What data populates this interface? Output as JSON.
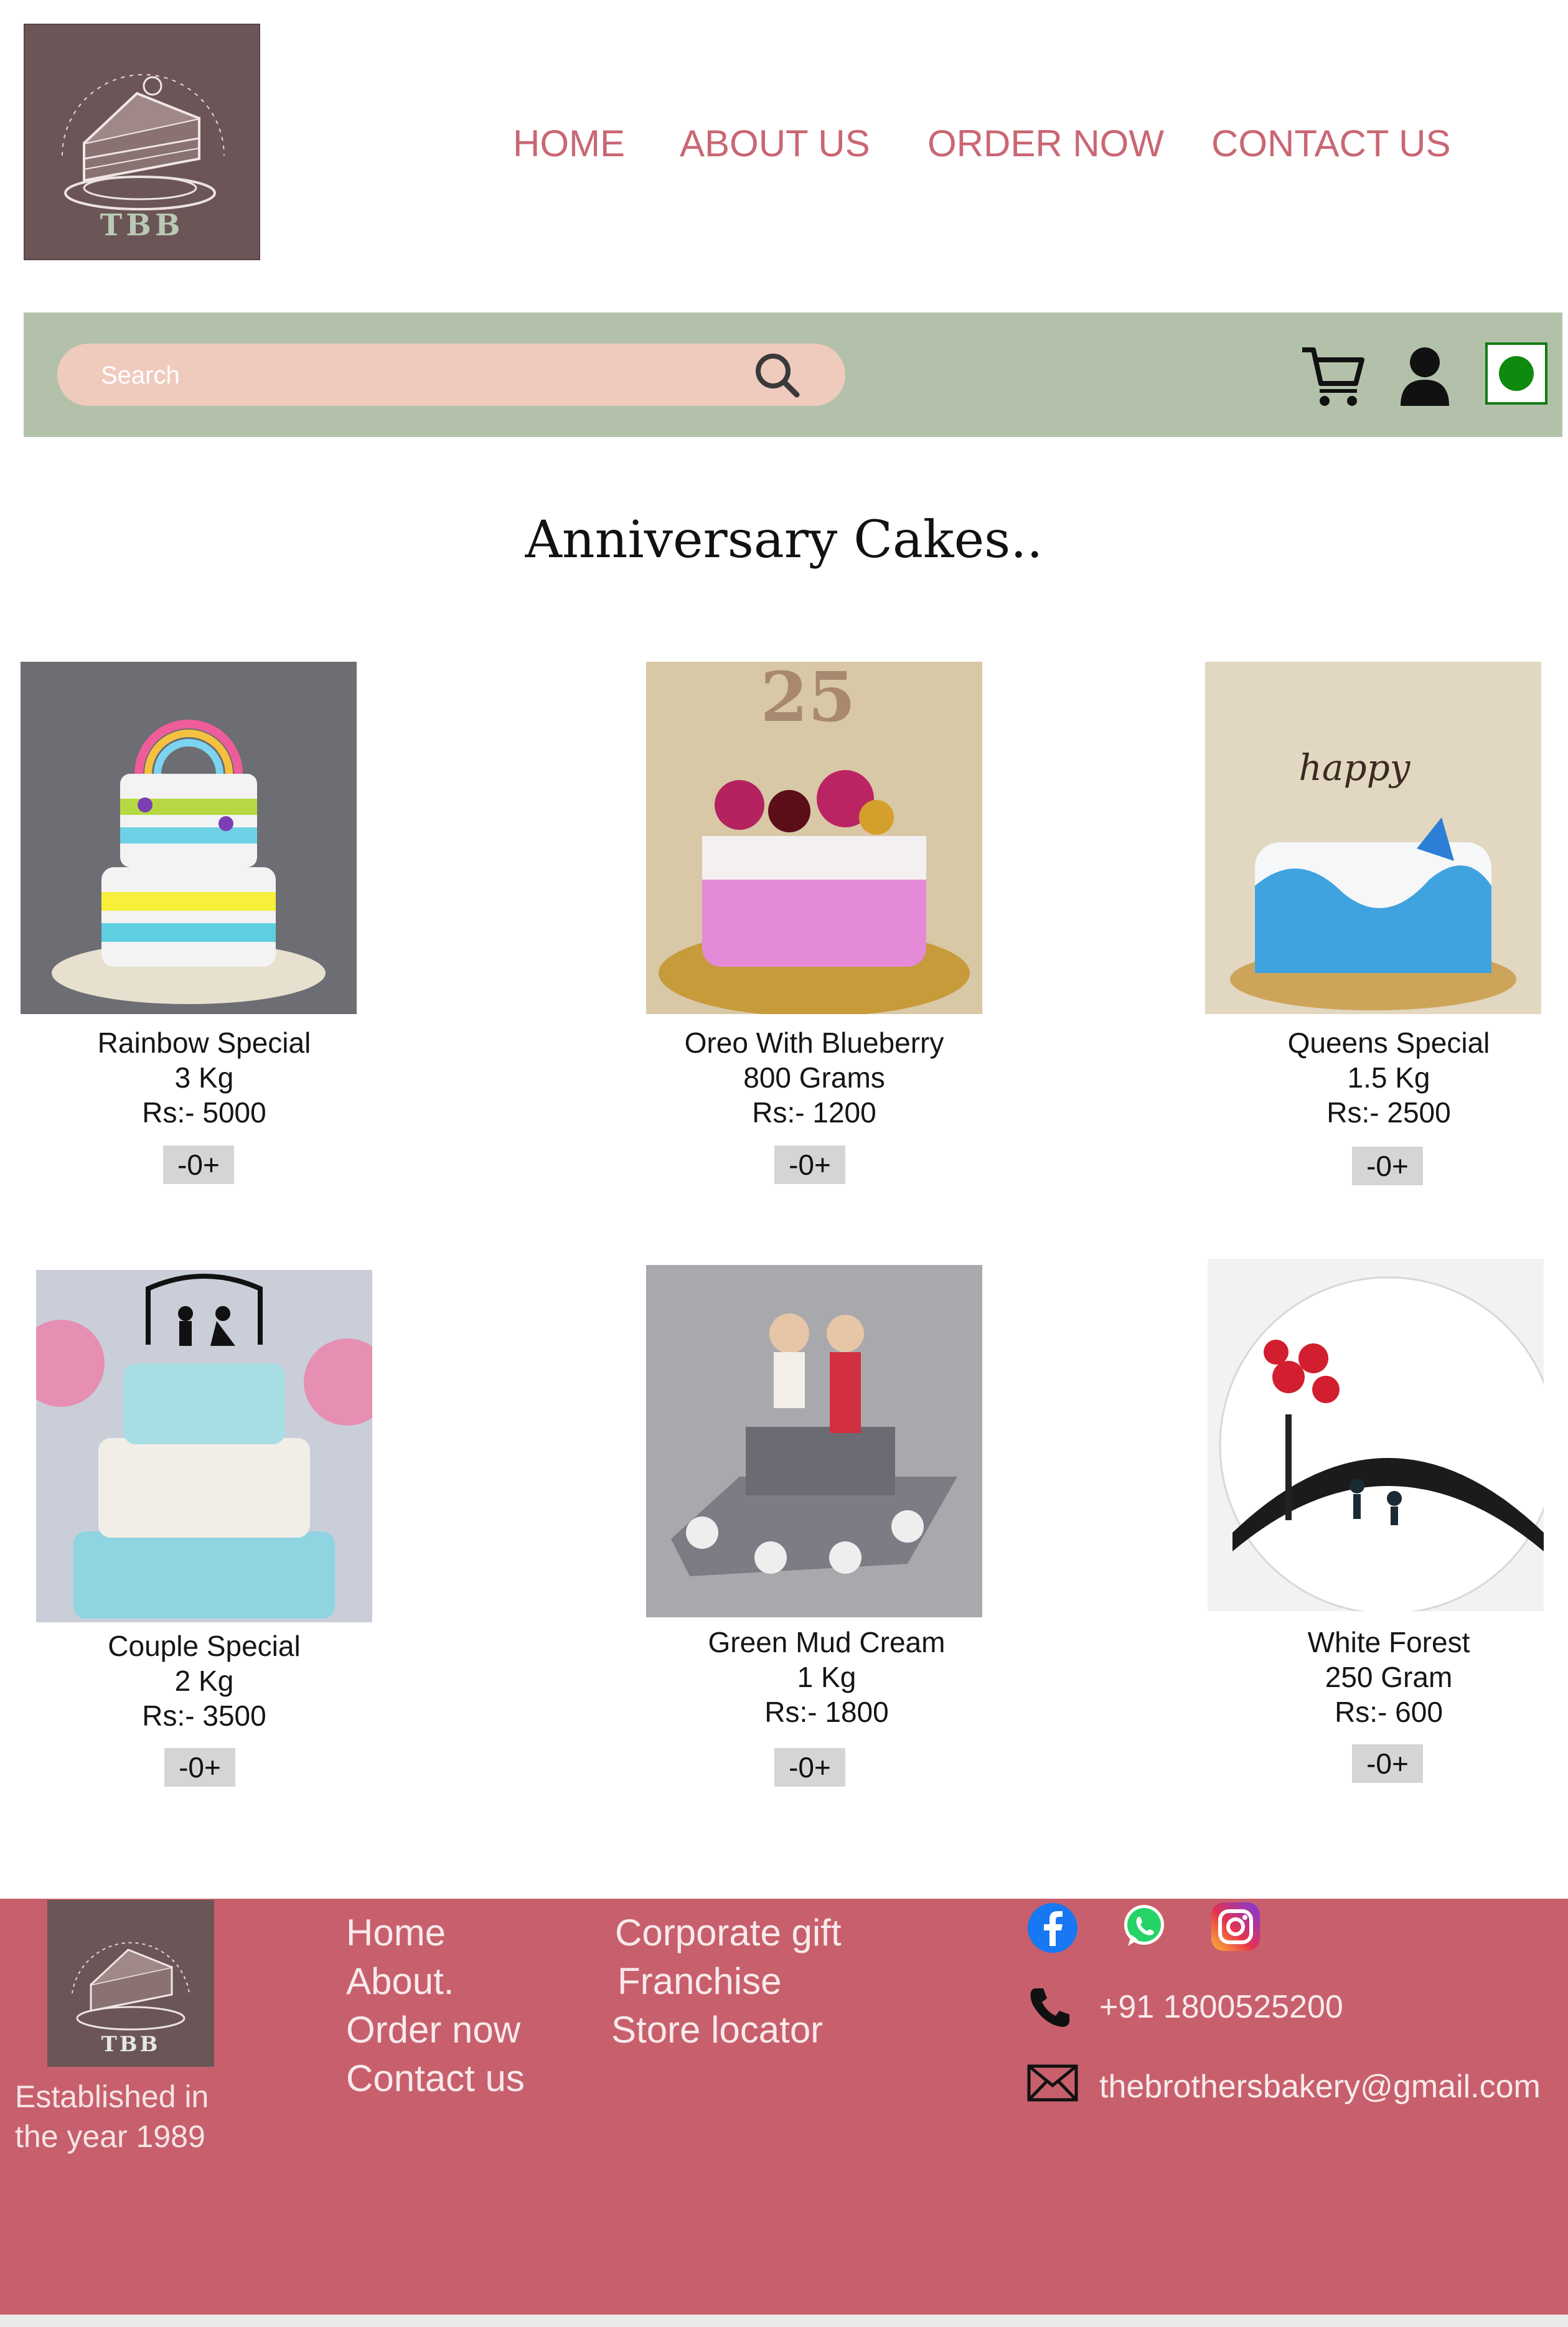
{
  "header": {
    "logo_text": "TBB",
    "nav": [
      "HOME",
      "ABOUT US",
      "ORDER NOW",
      "CONTACT US"
    ]
  },
  "search": {
    "placeholder": "Search"
  },
  "toolbar_icons": [
    "cart-icon",
    "user-icon",
    "green-dot-icon"
  ],
  "page_title": "Anniversary Cakes..",
  "products": [
    {
      "name": "Rainbow Special",
      "weight": "3 Kg",
      "price": "Rs:- 5000",
      "qty": "-0+"
    },
    {
      "name": "Oreo With Blueberry",
      "weight": "800 Grams",
      "price": "Rs:- 1200",
      "qty": "-0+"
    },
    {
      "name": "Queens Special",
      "weight": "1.5 Kg",
      "price": "Rs:- 2500",
      "qty": "-0+"
    },
    {
      "name": "Couple Special",
      "weight": "2 Kg",
      "price": "Rs:- 3500",
      "qty": "-0+"
    },
    {
      "name": "Green Mud Cream",
      "weight": "1 Kg",
      "price": "Rs:- 1800",
      "qty": "-0+"
    },
    {
      "name": "White Forest",
      "weight": "250 Gram",
      "price": "Rs:- 600",
      "qty": "-0+"
    }
  ],
  "footer": {
    "logo_text": "TBB",
    "established": "Established in the year 1989",
    "links_col1": [
      "Home",
      "About.",
      "Order now",
      "Contact us"
    ],
    "links_col2": [
      "Corporate gift",
      "Franchise",
      "Store locator"
    ],
    "social_icons": [
      "facebook-icon",
      "whatsapp-icon",
      "instagram-icon"
    ],
    "phone": "+91 1800525200",
    "email": "thebrothersbakery@gmail.com"
  },
  "colors": {
    "nav_text": "#c96773",
    "search_band": "#b3c1ab",
    "search_pill": "#efcbbe",
    "footer_bg": "#c7606c",
    "logo_bg": "#6b5556"
  }
}
